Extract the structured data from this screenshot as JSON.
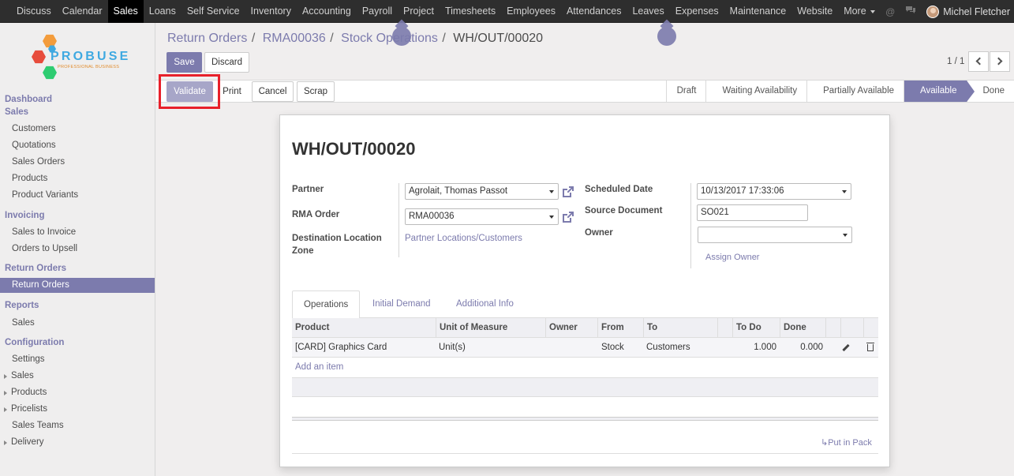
{
  "topbar": {
    "menu": [
      "Discuss",
      "Calendar",
      "Sales",
      "Loans",
      "Self Service",
      "Inventory",
      "Accounting",
      "Payroll",
      "Project",
      "Timesheets",
      "Employees",
      "Attendances",
      "Leaves",
      "Expenses",
      "Maintenance",
      "Website",
      "More"
    ],
    "active": "Sales",
    "user": "Michel Fletcher"
  },
  "logo": {
    "wordmark": "PROBUSE",
    "tagline": "PROFESSIONAL BUSINESS"
  },
  "sidebar": {
    "dashboard": "Dashboard",
    "sales_header": "Sales",
    "sales_items": [
      "Customers",
      "Quotations",
      "Sales Orders",
      "Products",
      "Product Variants"
    ],
    "invoicing_header": "Invoicing",
    "invoicing_items": [
      "Sales to Invoice",
      "Orders to Upsell"
    ],
    "returns_header": "Return Orders",
    "returns_items": [
      "Return Orders"
    ],
    "reports_header": "Reports",
    "reports_items": [
      "Sales"
    ],
    "config_header": "Configuration",
    "config_items": [
      "Settings",
      "Sales",
      "Products",
      "Pricelists",
      "Sales Teams",
      "Delivery"
    ]
  },
  "breadcrumb": {
    "items": [
      "Return Orders",
      "RMA00036",
      "Stock Operations"
    ],
    "current": "WH/OUT/00020",
    "sep": "/"
  },
  "buttons": {
    "save": "Save",
    "discard": "Discard",
    "validate": "Validate",
    "print": "Print",
    "cancel": "Cancel",
    "scrap": "Scrap"
  },
  "pager": {
    "value": "1 / 1"
  },
  "statusbar": {
    "states": [
      "Draft",
      "Waiting Availability",
      "Partially Available",
      "Available",
      "Done"
    ],
    "current": "Available"
  },
  "form": {
    "title": "WH/OUT/00020",
    "partner_label": "Partner",
    "partner_value": "Agrolait, Thomas Passot",
    "rma_label": "RMA Order",
    "rma_value": "RMA00036",
    "dest_label_1": "Destination Location",
    "dest_label_2": "Zone",
    "dest_value": "Partner Locations/Customers",
    "sched_label": "Scheduled Date",
    "sched_value": "10/13/2017 17:33:06",
    "source_label": "Source Document",
    "source_value": "SO021",
    "owner_label": "Owner",
    "owner_value": "",
    "assign_owner": "Assign Owner"
  },
  "tabs": [
    "Operations",
    "Initial Demand",
    "Additional Info"
  ],
  "table": {
    "headers": [
      "Product",
      "Unit of Measure",
      "Owner",
      "From",
      "To",
      "To Do",
      "Done"
    ],
    "rows": [
      {
        "product": "[CARD] Graphics Card",
        "uom": "Unit(s)",
        "owner": "",
        "from": "Stock",
        "to": "Customers",
        "todo": "1.000",
        "done": "0.000"
      }
    ],
    "add_item": "Add an item"
  },
  "put_in_pack": "↳Put in Pack",
  "colors": {
    "accent": "#7c7bad",
    "topbar": "#2e2e2e",
    "highlight": "#e8202a"
  }
}
